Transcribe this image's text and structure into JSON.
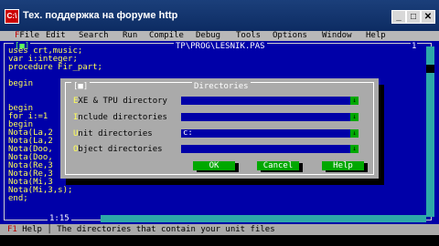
{
  "window": {
    "title": "Тех. поддержка на форуме http",
    "icon_text": "C:\\"
  },
  "menu": [
    {
      "label": "File"
    },
    {
      "label": "Edit"
    },
    {
      "label": "Search"
    },
    {
      "label": "Run"
    },
    {
      "label": "Compile"
    },
    {
      "label": "Debug"
    },
    {
      "label": "Tools"
    },
    {
      "label": "Options"
    },
    {
      "label": "Window"
    },
    {
      "label": "Help"
    }
  ],
  "editor": {
    "close_box": "[■]",
    "title": "TP\\PROG\\LESNIK.PAS",
    "window_number": "1",
    "code_lines": [
      "uses crt,music;",
      "var i:integer;",
      "procedure Fir_part;",
      "",
      "begin",
      "",
      "",
      "begin",
      "for i:=1",
      "begin",
      "Nota(La,2",
      "Nota(La,2",
      "Nota(Doo,",
      "Nota(Doo,",
      "Nota(Re,3",
      "Nota(Re,3",
      "Nota(Mi,3",
      "Nota(Mi,3,s);",
      "end;"
    ],
    "cursor_position": "1:15"
  },
  "dialog": {
    "title": "Directories",
    "close_box": "[■]",
    "fields": [
      {
        "hotkey": "E",
        "rest": "XE & TPU directory",
        "value": ""
      },
      {
        "hotkey": "I",
        "rest": "nclude directories",
        "value": ""
      },
      {
        "hotkey": "U",
        "rest": "nit directories",
        "value": "c:"
      },
      {
        "hotkey": "O",
        "rest": "bject directories",
        "value": ""
      }
    ],
    "history_glyph": "↓",
    "buttons": {
      "ok": "OK",
      "cancel": "Cancel",
      "help": "Help"
    }
  },
  "status": {
    "key": "F1",
    "key_label": " Help",
    "separator": " │ ",
    "message": "The directories that contain your unit files"
  }
}
